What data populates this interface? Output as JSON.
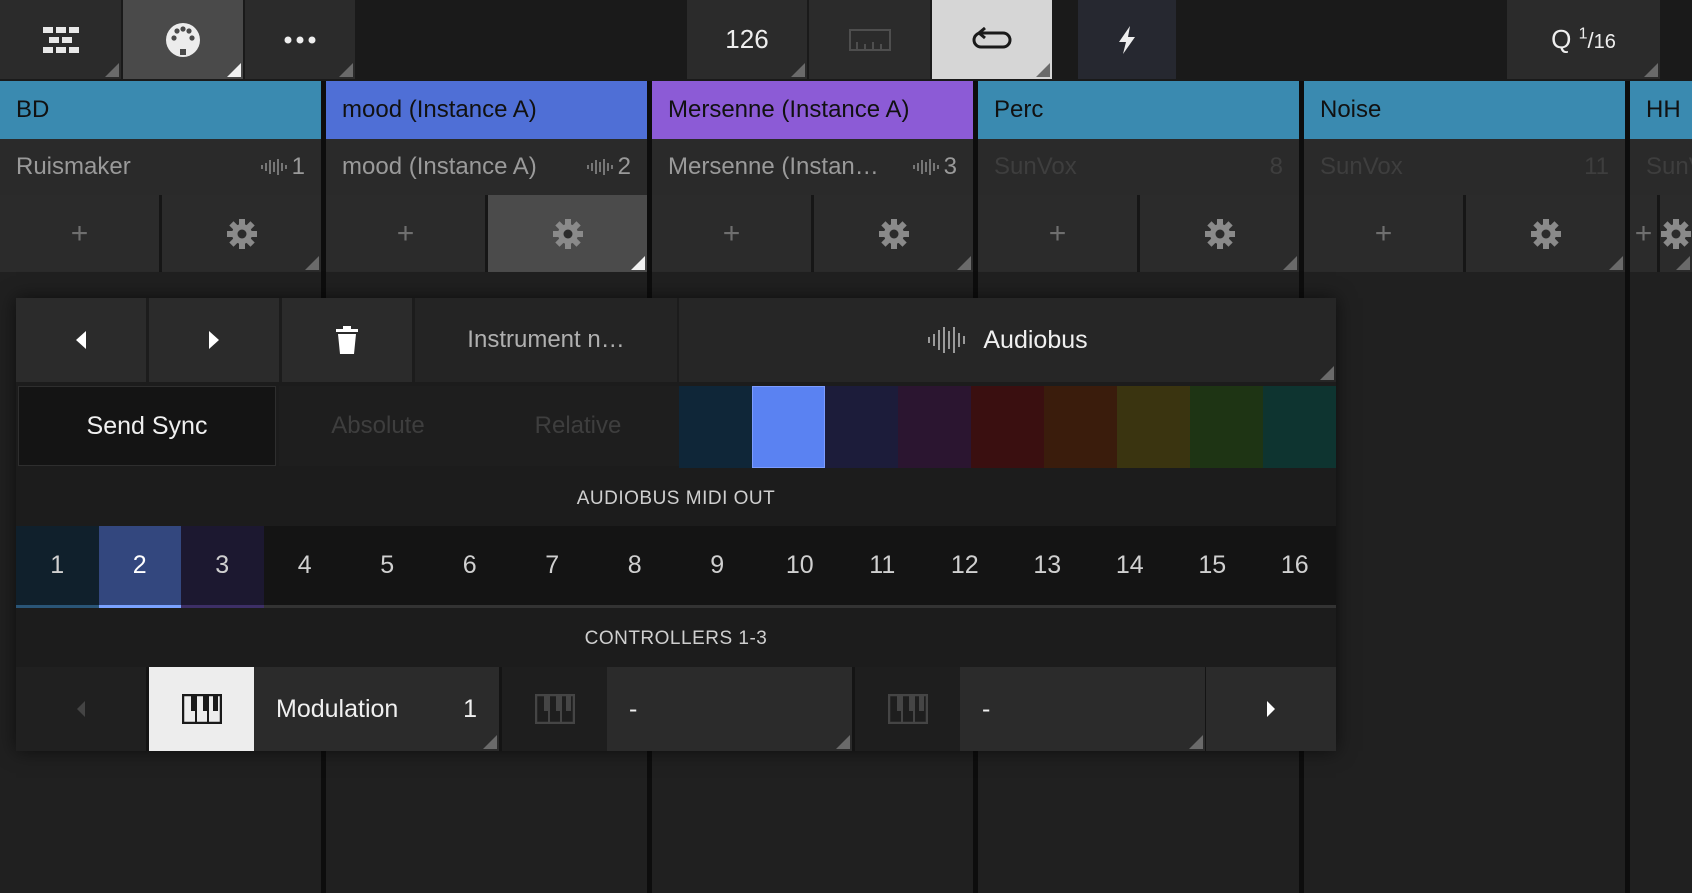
{
  "topbar": {
    "tempo": "126",
    "quantize_prefix": "Q",
    "quantize_num": "1",
    "quantize_den": "16",
    "icons": [
      "mixer-icon",
      "midi-icon",
      "more-icon",
      "metronome-icon",
      "loop-icon",
      "lightning-icon"
    ]
  },
  "tracks": [
    {
      "name": "BD",
      "instrument": "Ruismaker",
      "number": "1",
      "color": "#3a8ab0",
      "dim": false
    },
    {
      "name": "mood (Instance A)",
      "instrument": "mood (Instance A)",
      "number": "2",
      "color": "#4f6fd6",
      "dim": false
    },
    {
      "name": "Mersenne (Instance A)",
      "instrument": "Mersenne (Instan…",
      "number": "3",
      "color": "#8c5bd6",
      "dim": false
    },
    {
      "name": "Perc",
      "instrument": "SunVox",
      "number": "8",
      "color": "#3a8ab0",
      "dim": true
    },
    {
      "name": "Noise",
      "instrument": "SunVox",
      "number": "11",
      "color": "#3a8ab0",
      "dim": true
    },
    {
      "name": "HH",
      "instrument": "SunV",
      "number": "",
      "color": "#3a8ab0",
      "dim": true
    }
  ],
  "panel": {
    "instrument_name_placeholder": "Instrument n…",
    "audiobus_label": "Audiobus",
    "send_sync_label": "Send Sync",
    "absolute_label": "Absolute",
    "relative_label": "Relative",
    "swatches": [
      "#0f2638",
      "#5a82f2",
      "#1c1c3a",
      "#2b1530",
      "#3a0f10",
      "#3a1c0c",
      "#3a3410",
      "#1e3414",
      "#0e3430"
    ],
    "selected_swatch": 1,
    "midi_out_title": "AUDIOBUS MIDI OUT",
    "channels": [
      "1",
      "2",
      "3",
      "4",
      "5",
      "6",
      "7",
      "8",
      "9",
      "10",
      "11",
      "12",
      "13",
      "14",
      "15",
      "16"
    ],
    "selected_channel": "2",
    "controllers_title": "CONTROLLERS 1-3",
    "controllers": [
      {
        "name": "Modulation",
        "value": "1",
        "learn_active": true
      },
      {
        "name": "-",
        "value": "",
        "learn_active": false
      },
      {
        "name": "-",
        "value": "",
        "learn_active": false
      }
    ]
  }
}
